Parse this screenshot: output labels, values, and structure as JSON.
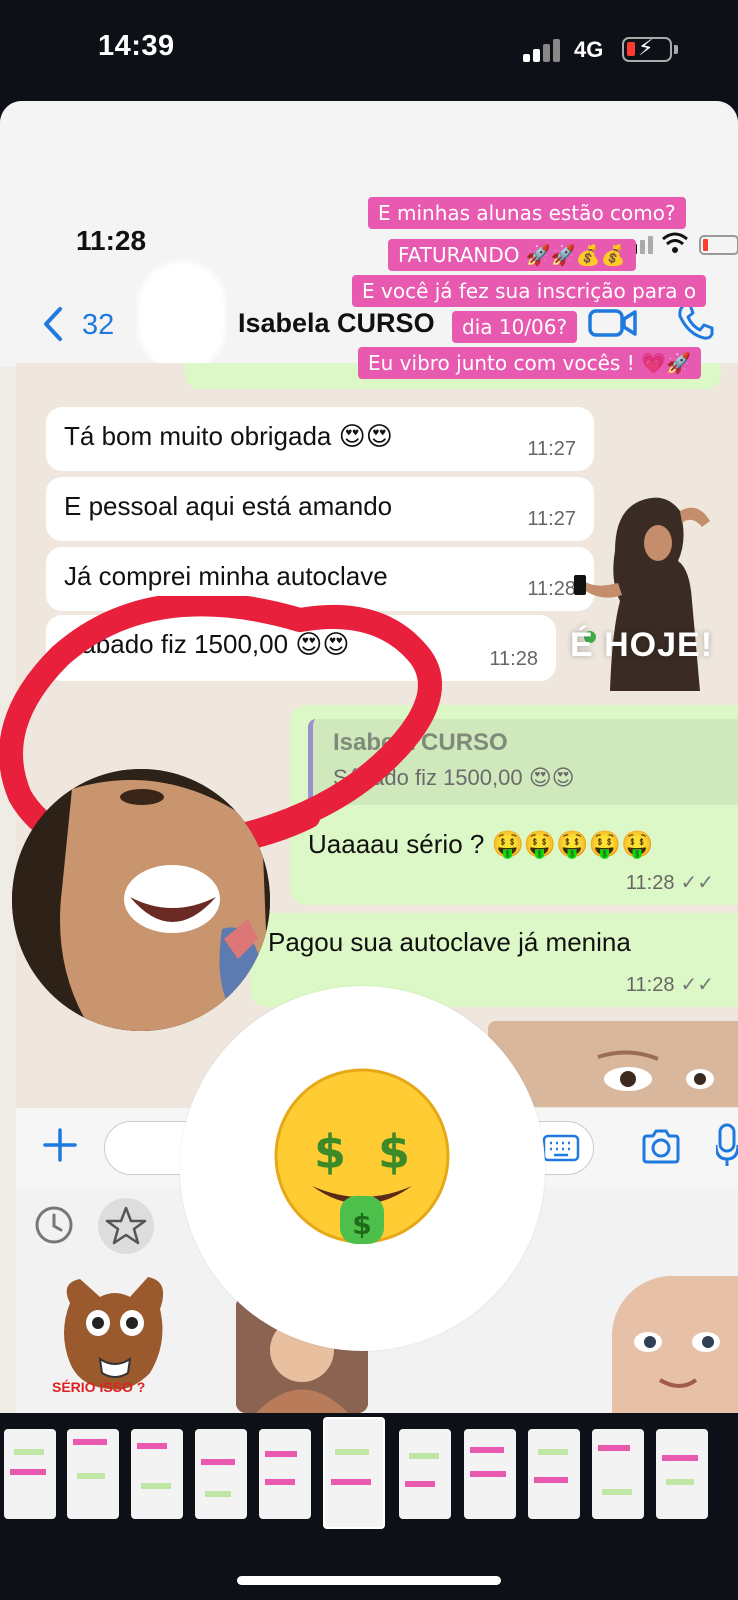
{
  "status_bar": {
    "time": "14:39",
    "network": "4G",
    "battery_level": 0.2
  },
  "inner_status": {
    "time": "11:28"
  },
  "chat_header": {
    "back_count": "32",
    "contact_name": "Isabela CURSO"
  },
  "story_overlay": {
    "lines": [
      "E minhas alunas estão como?",
      "FATURANDO 🚀🚀💰💰",
      "E você já fez sua inscrição para o",
      "dia 10/06?",
      "Eu vibro junto com vocês ! 💗🚀"
    ]
  },
  "messages": [
    {
      "text": "Tá bom muito obrigada 😍😍",
      "time": "11:27"
    },
    {
      "text": "E pessoal aqui está amando",
      "time": "11:27"
    },
    {
      "text": "Já comprei minha autoclave",
      "time": "11:28"
    },
    {
      "text": "Sábado fiz 1500,00 😍😍",
      "time": "11:28"
    }
  ],
  "reply": {
    "quoted_name": "Isabela CURSO",
    "quoted_text": "Sábado fiz 1500,00 😍😍",
    "text": "Uaaaau sério ? 🤑🤑🤑🤑🤑",
    "time": "11:28"
  },
  "outgoing2": {
    "text": "Pagou sua autoclave já menina",
    "time": "11:28"
  },
  "sticker_overlay": {
    "text": "É HOJE!"
  },
  "big_emoji": "🤑",
  "sticker_label": "SÉRIO ISSO ?",
  "colors": {
    "whatsapp_blue": "#1f7ae0",
    "pink_overlay": "#e85ab0",
    "outgoing_bubble": "#dcf8c6",
    "red_circle": "#e8203c"
  }
}
